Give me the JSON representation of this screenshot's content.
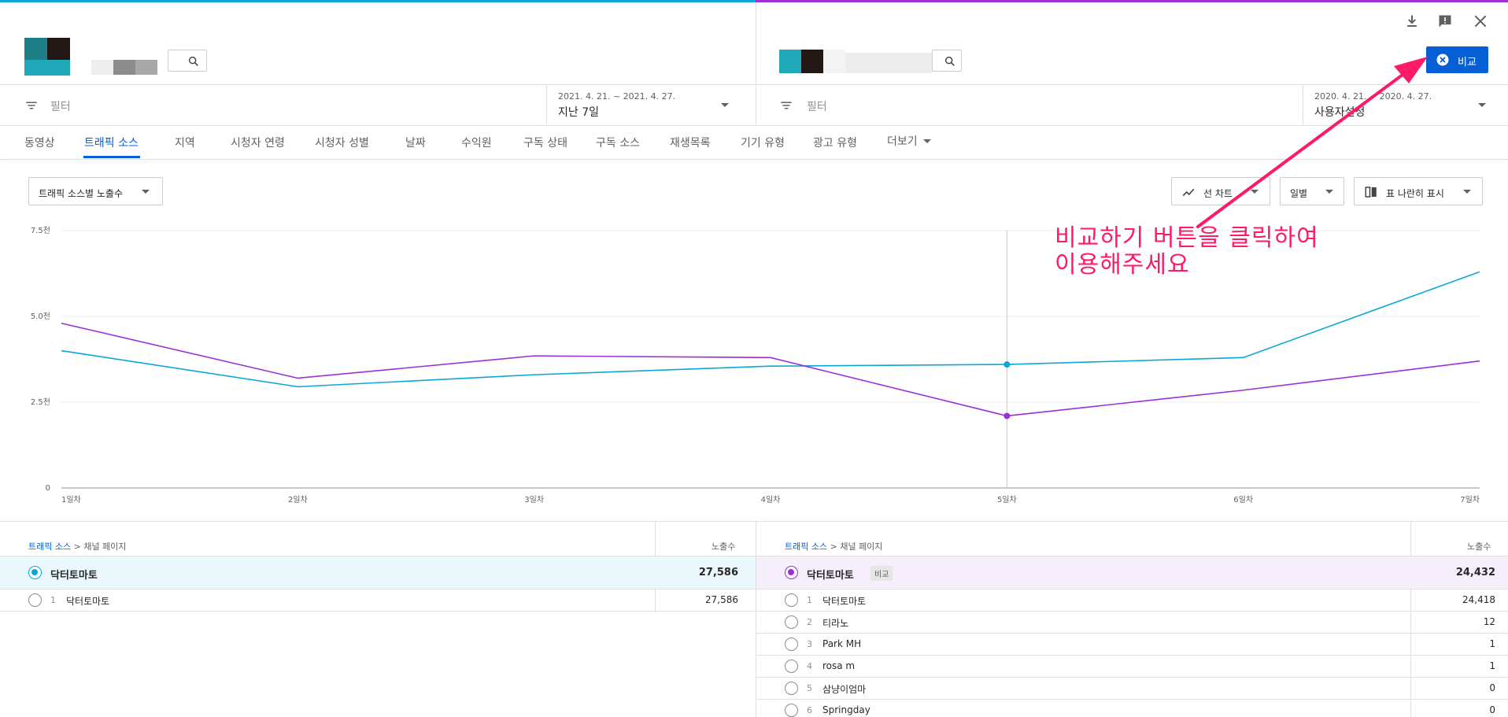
{
  "toolbar": {
    "download_icon": "download-icon",
    "feedback_icon": "feedback-icon",
    "close_icon": "close-icon",
    "compare_button_label": "비교"
  },
  "left_panel": {
    "filter_label": "필터",
    "date_range": "2021. 4. 21. ~ 2021. 4. 27.",
    "date_preset": "지난 7일"
  },
  "right_panel": {
    "filter_label": "필터",
    "date_range": "2020. 4. 21. ~ 2020. 4. 27.",
    "date_preset": "사용자설정"
  },
  "tabs": [
    {
      "label": "동영상"
    },
    {
      "label": "트래픽 소스"
    },
    {
      "label": "지역"
    },
    {
      "label": "시청자 연령"
    },
    {
      "label": "시청자 성별"
    },
    {
      "label": "날짜"
    },
    {
      "label": "수익원"
    },
    {
      "label": "구독 상태"
    },
    {
      "label": "구독 소스"
    },
    {
      "label": "재생목록"
    },
    {
      "label": "기기 유형"
    },
    {
      "label": "광고 유형"
    },
    {
      "label": "더보기"
    }
  ],
  "controls": {
    "metric_select": "트래픽 소스별 노출수",
    "chart_type": "선 차트",
    "granularity": "일별",
    "view_mode": "표 나란히 표시"
  },
  "annotation": {
    "line1": "비교하기 버튼을 클릭하여",
    "line2": "이용해주세요"
  },
  "chart_data": {
    "type": "line",
    "categories": [
      "1일차",
      "2일차",
      "3일차",
      "4일차",
      "5일차",
      "6일차",
      "7일차"
    ],
    "yticks": [
      "0",
      "2.5천",
      "5.0천",
      "7.5천"
    ],
    "ylim": [
      0,
      7500
    ],
    "grid": true,
    "highlight_index": 4,
    "series": [
      {
        "color": "#0aa6d8",
        "values": [
          4000,
          2950,
          3300,
          3550,
          3600,
          3800,
          6300
        ]
      },
      {
        "color": "#9c2fd6",
        "values": [
          4800,
          3200,
          3850,
          3800,
          2100,
          2850,
          3700
        ]
      }
    ]
  },
  "left_table": {
    "breadcrumb_link": "트래픽 소스",
    "breadcrumb_sep": ">",
    "breadcrumb_current": "채널 페이지",
    "column_header": "노출수",
    "total_row": {
      "name": "닥터토마토",
      "value": "27,586"
    },
    "rows": [
      {
        "idx": "1",
        "name": "닥터토마토",
        "value": "27,586"
      }
    ]
  },
  "right_table": {
    "breadcrumb_link": "트래픽 소스",
    "breadcrumb_sep": ">",
    "breadcrumb_current": "채널 페이지",
    "column_header": "노출수",
    "total_row": {
      "name": "닥터토마토",
      "badge": "비교",
      "value": "24,432"
    },
    "rows": [
      {
        "idx": "1",
        "name": "닥터토마토",
        "value": "24,418"
      },
      {
        "idx": "2",
        "name": "티라노",
        "value": "12"
      },
      {
        "idx": "3",
        "name": "Park MH",
        "value": "1"
      },
      {
        "idx": "4",
        "name": "rosa m",
        "value": "1"
      },
      {
        "idx": "5",
        "name": "삼냥이엄마",
        "value": "0"
      },
      {
        "idx": "6",
        "name": "Springday",
        "value": "0"
      }
    ]
  }
}
